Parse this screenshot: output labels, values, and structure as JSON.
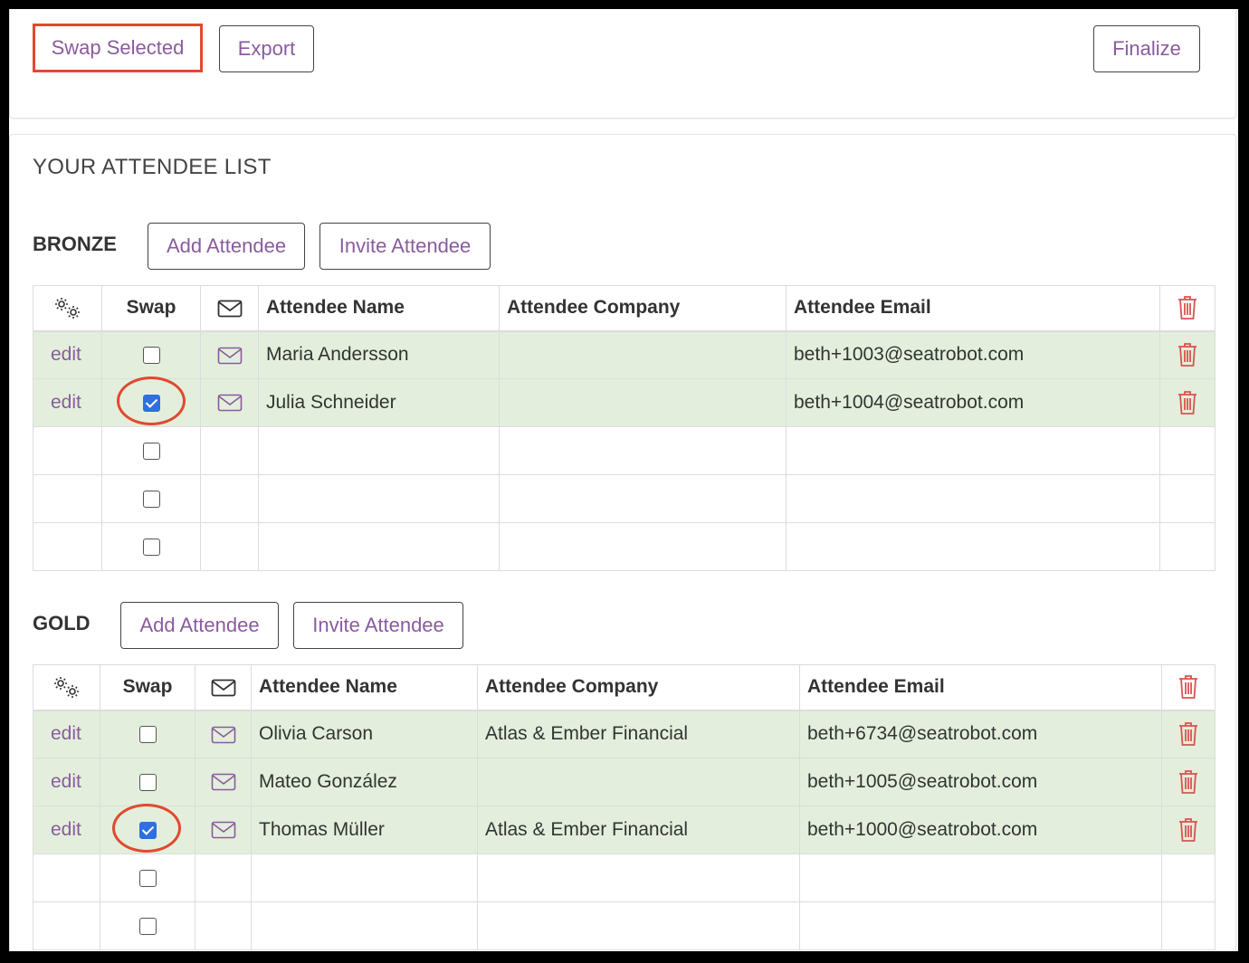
{
  "toolbar": {
    "swap_selected_label": "Swap Selected",
    "export_label": "Export",
    "finalize_label": "Finalize"
  },
  "list": {
    "title": "YOUR ATTENDEE LIST"
  },
  "columns": {
    "swap": "Swap",
    "name": "Attendee Name",
    "company": "Attendee Company",
    "email": "Attendee Email"
  },
  "tiers": [
    {
      "label": "BRONZE",
      "add_label": "Add Attendee",
      "invite_label": "Invite Attendee",
      "rows": [
        {
          "edit": "edit",
          "checked": false,
          "name": "Maria Andersson",
          "company": "",
          "email": "beth+1003@seatrobot.com"
        },
        {
          "edit": "edit",
          "checked": true,
          "name": "Julia Schneider",
          "company": "",
          "email": "beth+1004@seatrobot.com"
        }
      ],
      "empty_rows": 3
    },
    {
      "label": "GOLD",
      "add_label": "Add Attendee",
      "invite_label": "Invite Attendee",
      "rows": [
        {
          "edit": "edit",
          "checked": false,
          "name": "Olivia Carson",
          "company": "Atlas & Ember Financial",
          "email": "beth+6734@seatrobot.com"
        },
        {
          "edit": "edit",
          "checked": false,
          "name": "Mateo González",
          "company": "",
          "email": "beth+1005@seatrobot.com"
        },
        {
          "edit": "edit",
          "checked": true,
          "name": "Thomas Müller",
          "company": "Atlas & Ember Financial",
          "email": "beth+1000@seatrobot.com"
        }
      ],
      "empty_rows": 2
    }
  ],
  "colors": {
    "accent_purple": "#8a5b9e",
    "highlight_red": "#e2492f",
    "row_green": "#e3efdc",
    "trash_red": "#d9534f",
    "checkbox_blue": "#2f6fe0"
  },
  "icons": {
    "settings": "gears-icon",
    "envelope": "envelope-icon",
    "trash": "trash-icon"
  }
}
